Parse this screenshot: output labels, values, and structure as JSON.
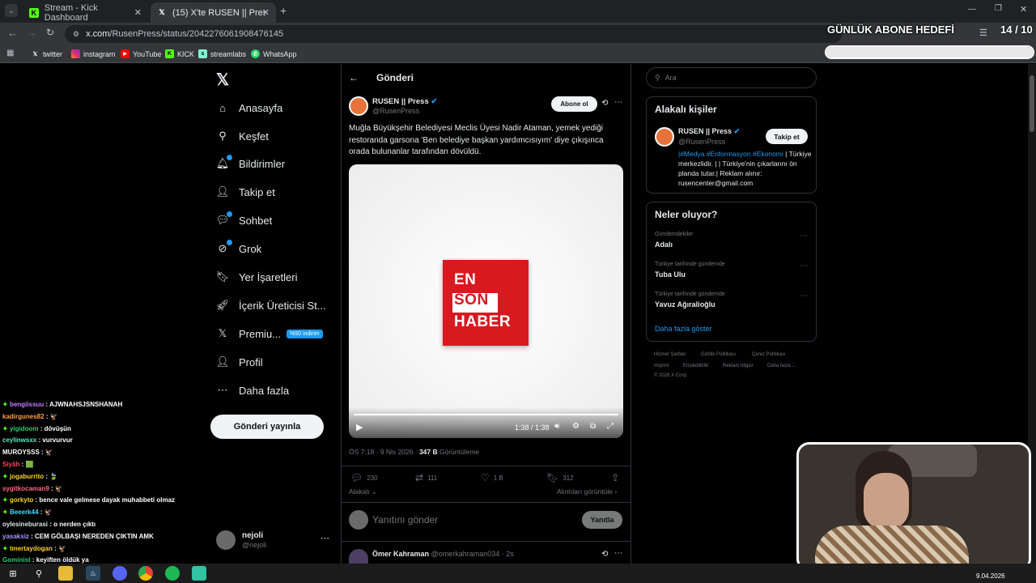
{
  "browser": {
    "tabs": [
      {
        "label": "Stream - Kick Dashboard",
        "favicon": "kick-icon"
      },
      {
        "label": "(15) X'te RUSEN || Press: \"Muğla",
        "favicon": "x-icon"
      }
    ],
    "url_host": "x.com",
    "url_path": "/RusenPress/status/2042276061908476145",
    "bookmarks": [
      "twitter",
      "instagram",
      "YouTube",
      "KICK",
      "streamlabs",
      "WhatsApp"
    ]
  },
  "nav": {
    "items": [
      "Anasayfa",
      "Keşfet",
      "Bildirimler",
      "Takip et",
      "Sohbet",
      "Grok",
      "Yer İşaretleri",
      "İçerik Üreticisi St...",
      "Premiu...",
      "Profil",
      "Daha fazla"
    ],
    "premium_badge": "%50 indirim",
    "post_button": "Gönderi yayınla",
    "account_name": "nejoli",
    "account_handle": "@nejoli"
  },
  "header": {
    "title": "Gönderi"
  },
  "tweet": {
    "author": "RUSEN || Press",
    "handle": "@RusenPress",
    "subscribe": "Abone ol",
    "text": "Muğla Büyükşehir Belediyesi Meclis Üyesi Nadir Ataman, yemek yediği restoranda garsona 'Ben belediye başkan yardımcısıyım' diye çıkışınca orada bulunanlar tarafından dövüldü.",
    "media_logo": [
      "EN",
      "SON",
      "HABER"
    ],
    "video_time": "1:38 / 1:38",
    "video_progress": 1.0,
    "meta_time": "ÖS 7:18 · 9 Nis 2026 ·",
    "views": "347 B",
    "views_label": "Görüntüleme",
    "replies": "230",
    "reposts": "111",
    "likes": "1 B",
    "bookmarks": "312",
    "relevance": "Alakalı",
    "quotes_link": "Alıntıları görüntüle",
    "reply_placeholder": "Yanıtını gönder",
    "reply_button": "Yanıtla",
    "next_author": "Ömer Kahraman",
    "next_handle": "@omerkahraman034 · 2s"
  },
  "right": {
    "search_placeholder": "Ara",
    "related_title": "Alakalı kişiler",
    "related_name": "RUSEN || Press",
    "related_handle": "@RusenPress",
    "follow_button": "Takip et",
    "bio_hashtags": "|#Medya #Enformasyon #Ekonomi",
    "bio_rest": "| Türkiye merkezlidir. | | Türkiye'nin çıkarlarını ön planda tutar.| Reklam alınır: rusencenter@gmail.com",
    "trends_title": "Neler oluyor?",
    "trends": [
      {
        "context": "Gündemdekiler",
        "name": "Adalı"
      },
      {
        "context": "Türkiye tarihinde gündemde",
        "name": "Tuba Ulu"
      },
      {
        "context": "Türkiye tarihinde gündemde",
        "name": "Yavuz Ağıralioğlu"
      }
    ],
    "show_more": "Daha fazla göster",
    "footer_line1": [
      "Hizmet Şartları",
      "Gizlilik Politikası",
      "Çerez Politikası"
    ],
    "footer_line2": [
      "Imprint",
      "Erişilebilirlik",
      "Reklam bilgisi",
      "Daha fazla ..."
    ],
    "copyright": "© 2026 X Corp."
  },
  "overlay": {
    "goal_title": "GÜNLÜK ABONE HEDEFİ",
    "goal_count": "14 / 10",
    "goal_fraction": 1.0
  },
  "chat": [
    {
      "user": "bengiissuu",
      "color": "#c77dff",
      "msg": "AJWNAHSJSNSHANAH",
      "badge": true
    },
    {
      "user": "kadirgunes82",
      "color": "#ff9f43",
      "msg": "🦅",
      "badge": false
    },
    {
      "user": "yigidoom",
      "color": "#2ecc71",
      "msg": "dövüşün",
      "badge": true
    },
    {
      "user": "ceylinwsxx",
      "color": "#55efc4",
      "msg": "vurvurvur",
      "badge": false
    },
    {
      "user": "MUROYSSS",
      "color": "#ffffff",
      "msg": "🦅",
      "badge": false
    },
    {
      "user": "Siyâh",
      "color": "#ff4757",
      "msg": "🟩",
      "badge": false
    },
    {
      "user": "jogaburrito",
      "color": "#ffd32a",
      "msg": "🍃",
      "badge": true
    },
    {
      "user": "sygitkocaman9",
      "color": "#ff6b81",
      "msg": "🦅",
      "badge": false
    },
    {
      "user": "gorkyto",
      "color": "#ffd32a",
      "msg": "bence vale gelmese dayak muhabbeti olmaz",
      "badge": true
    },
    {
      "user": "Beeerk44",
      "color": "#48dbfb",
      "msg": "🦅",
      "badge": true
    },
    {
      "user": "oylesineburasi",
      "color": "#dfe6e9",
      "msg": "o nerden çıktı",
      "badge": false
    },
    {
      "user": "yasaksiz",
      "color": "#a29bfe",
      "msg": "CEM GÖLBAŞI NEREDEN ÇIKTIN AMK",
      "badge": false
    },
    {
      "user": "tmertaydogan",
      "color": "#ffd32a",
      "msg": "🦅",
      "badge": true
    },
    {
      "user": "Gominist",
      "color": "#2ecc71",
      "msg": "keyiften öldük ya",
      "badge": false
    }
  ],
  "taskbar": {
    "date": "9.04.2026"
  },
  "colors": {
    "accent": "#1d9bf0",
    "kick": "#53fc18",
    "logo_red": "#d71920"
  }
}
